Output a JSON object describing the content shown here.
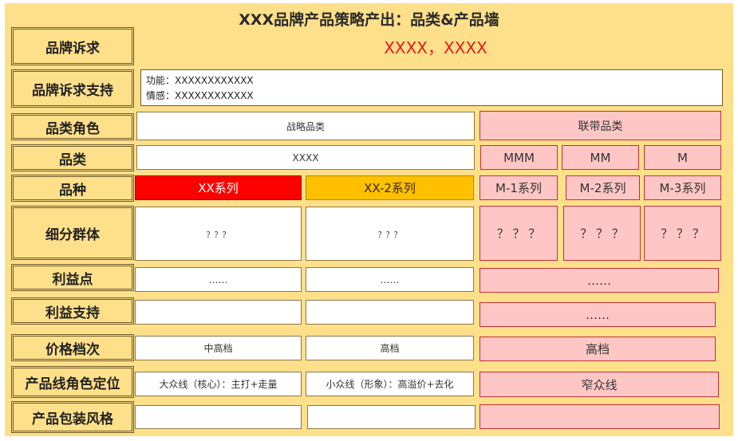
{
  "title": "XXX品牌产品策略产出：品类&产品墙",
  "row_labels": [
    "品牌诉求",
    "品牌诉求支持",
    "品类角色",
    "品类",
    "品种",
    "细分群体",
    "利益点",
    "利益支持",
    "价格档次",
    "产品线角色定位",
    "产品包装风格"
  ],
  "brand_claim": "XXXX，XXXX",
  "claim_support": [
    "功能：XXXXXXXXXXXX",
    "情感：XXXXXXXXXXXX"
  ],
  "category_role": {
    "strategic": "战略品类",
    "linked": "联带品类"
  },
  "category": {
    "strategic": "XXXX",
    "linked": [
      "MMM",
      "MM",
      "M"
    ]
  },
  "variety": [
    "XX系列",
    "XX-2系列",
    "M-1系列",
    "M-2系列",
    "M-3系列"
  ],
  "segments": [
    "？？？",
    "？？？",
    "？ ？ ？",
    "？ ？ ？",
    "？ ？ ？"
  ],
  "benefits": [
    "……",
    "……",
    "……"
  ],
  "benefit_support": [
    "",
    "",
    "……"
  ],
  "price_tier": [
    "中高档",
    "高档",
    "高档"
  ],
  "line_role": [
    "大众线（核心）：主打+走量",
    "小众线（形象）：高溢价+去化",
    "窄众线"
  ],
  "packaging": [
    "",
    "",
    ""
  ],
  "colors": {
    "background": "#ffe08a",
    "accent_red": "#ff0000",
    "accent_orange": "#ffc000",
    "pink": "#ffc6c6",
    "claim_text": "#e31c1c"
  }
}
